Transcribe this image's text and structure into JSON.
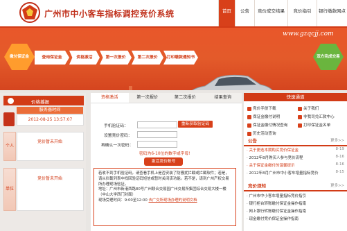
{
  "header": {
    "site_title": "广州市中小客车指标调控竞价系统",
    "nav": [
      "首页",
      "公告",
      "竞价成交结果",
      "竞价指引",
      "银行缴款网点"
    ]
  },
  "banner": {
    "url_text": "www.gzqcjj.com",
    "start_hex": "缴付保证金",
    "steps": [
      "查询保证金",
      "资格激活",
      "第一次报价",
      "第二次报价",
      "打印缴款通知书"
    ],
    "end_hex": "双方完成交易"
  },
  "left": {
    "price_board_title": "价格播报",
    "server_time_label": "服务器时间",
    "server_time": "2012-08-25 13:57:07",
    "personal_tab": "个人",
    "personal_price": "竞价暂未开始",
    "unit_tab": "单位",
    "unit_price": "竞价暂未开始"
  },
  "middle": {
    "tabs": [
      "资格激活",
      "第一次报价",
      "第二次报价",
      "结果查询"
    ],
    "phone_label": "手机验证码：",
    "get_code_button": "重新获取验证码",
    "set_pw_label": "设置竞价密码：",
    "confirm_pw_label": "再确认一次密码：",
    "pw_hint": "密码为6-10位的数字或字母!",
    "activate_button": "激活竞价账号",
    "notice_p1": "若收不到手机验证码，请查看手机上是否安装了防骚扰拦截或拦截软件；若是，请从拦截列表中找回验证码短信或暂时关闭该功能。若不是，请到广州产权交易所办理现场验证。",
    "notice_addr": "地址：广州市新港西路80号广州联合交易园广州交易所集团综合交易大楼一楼（中山大学西门对面）",
    "notice_hours": "现场受理时间：9:00至12:00",
    "notice_link": "去广交所现场办理的说明文档"
  },
  "right": {
    "quick_title": "快速通道",
    "quick_links": [
      "竞价手册下载",
      "保证金缴付说明",
      "保证金缴付情况查询",
      "历史活动查询",
      "关于我们",
      "非我司兑汇款中心",
      "打印保证金名单"
    ],
    "announce_title": "公告",
    "announce_more": "更多>>",
    "announcements": [
      {
        "text": "关于更迭本期购买竞价保证金",
        "date": "8-19",
        "red": true
      },
      {
        "text": "2012年8月购买人参与竞价流程",
        "date": "8-16",
        "red": false
      },
      {
        "text": "关于保证金缴付的温馨提示",
        "date": "8-16",
        "red": true
      },
      {
        "text": "2012年8月广州市中小客车增量指标竞价",
        "date": "8-15",
        "red": false
      }
    ],
    "guide_title": "竞价须知",
    "guide_more": "更多>>",
    "guides": [
      "广州市中小客车增量指标竞价指引",
      "银行柜台转账缴付保证金操作指南",
      "网上银行转账缴付保证金操作指南",
      "现金缴付竞价保证金操作指南"
    ]
  },
  "colors": {
    "brand": "#d23b16",
    "accent": "#ff9c2d",
    "green": "#6ab53e"
  }
}
